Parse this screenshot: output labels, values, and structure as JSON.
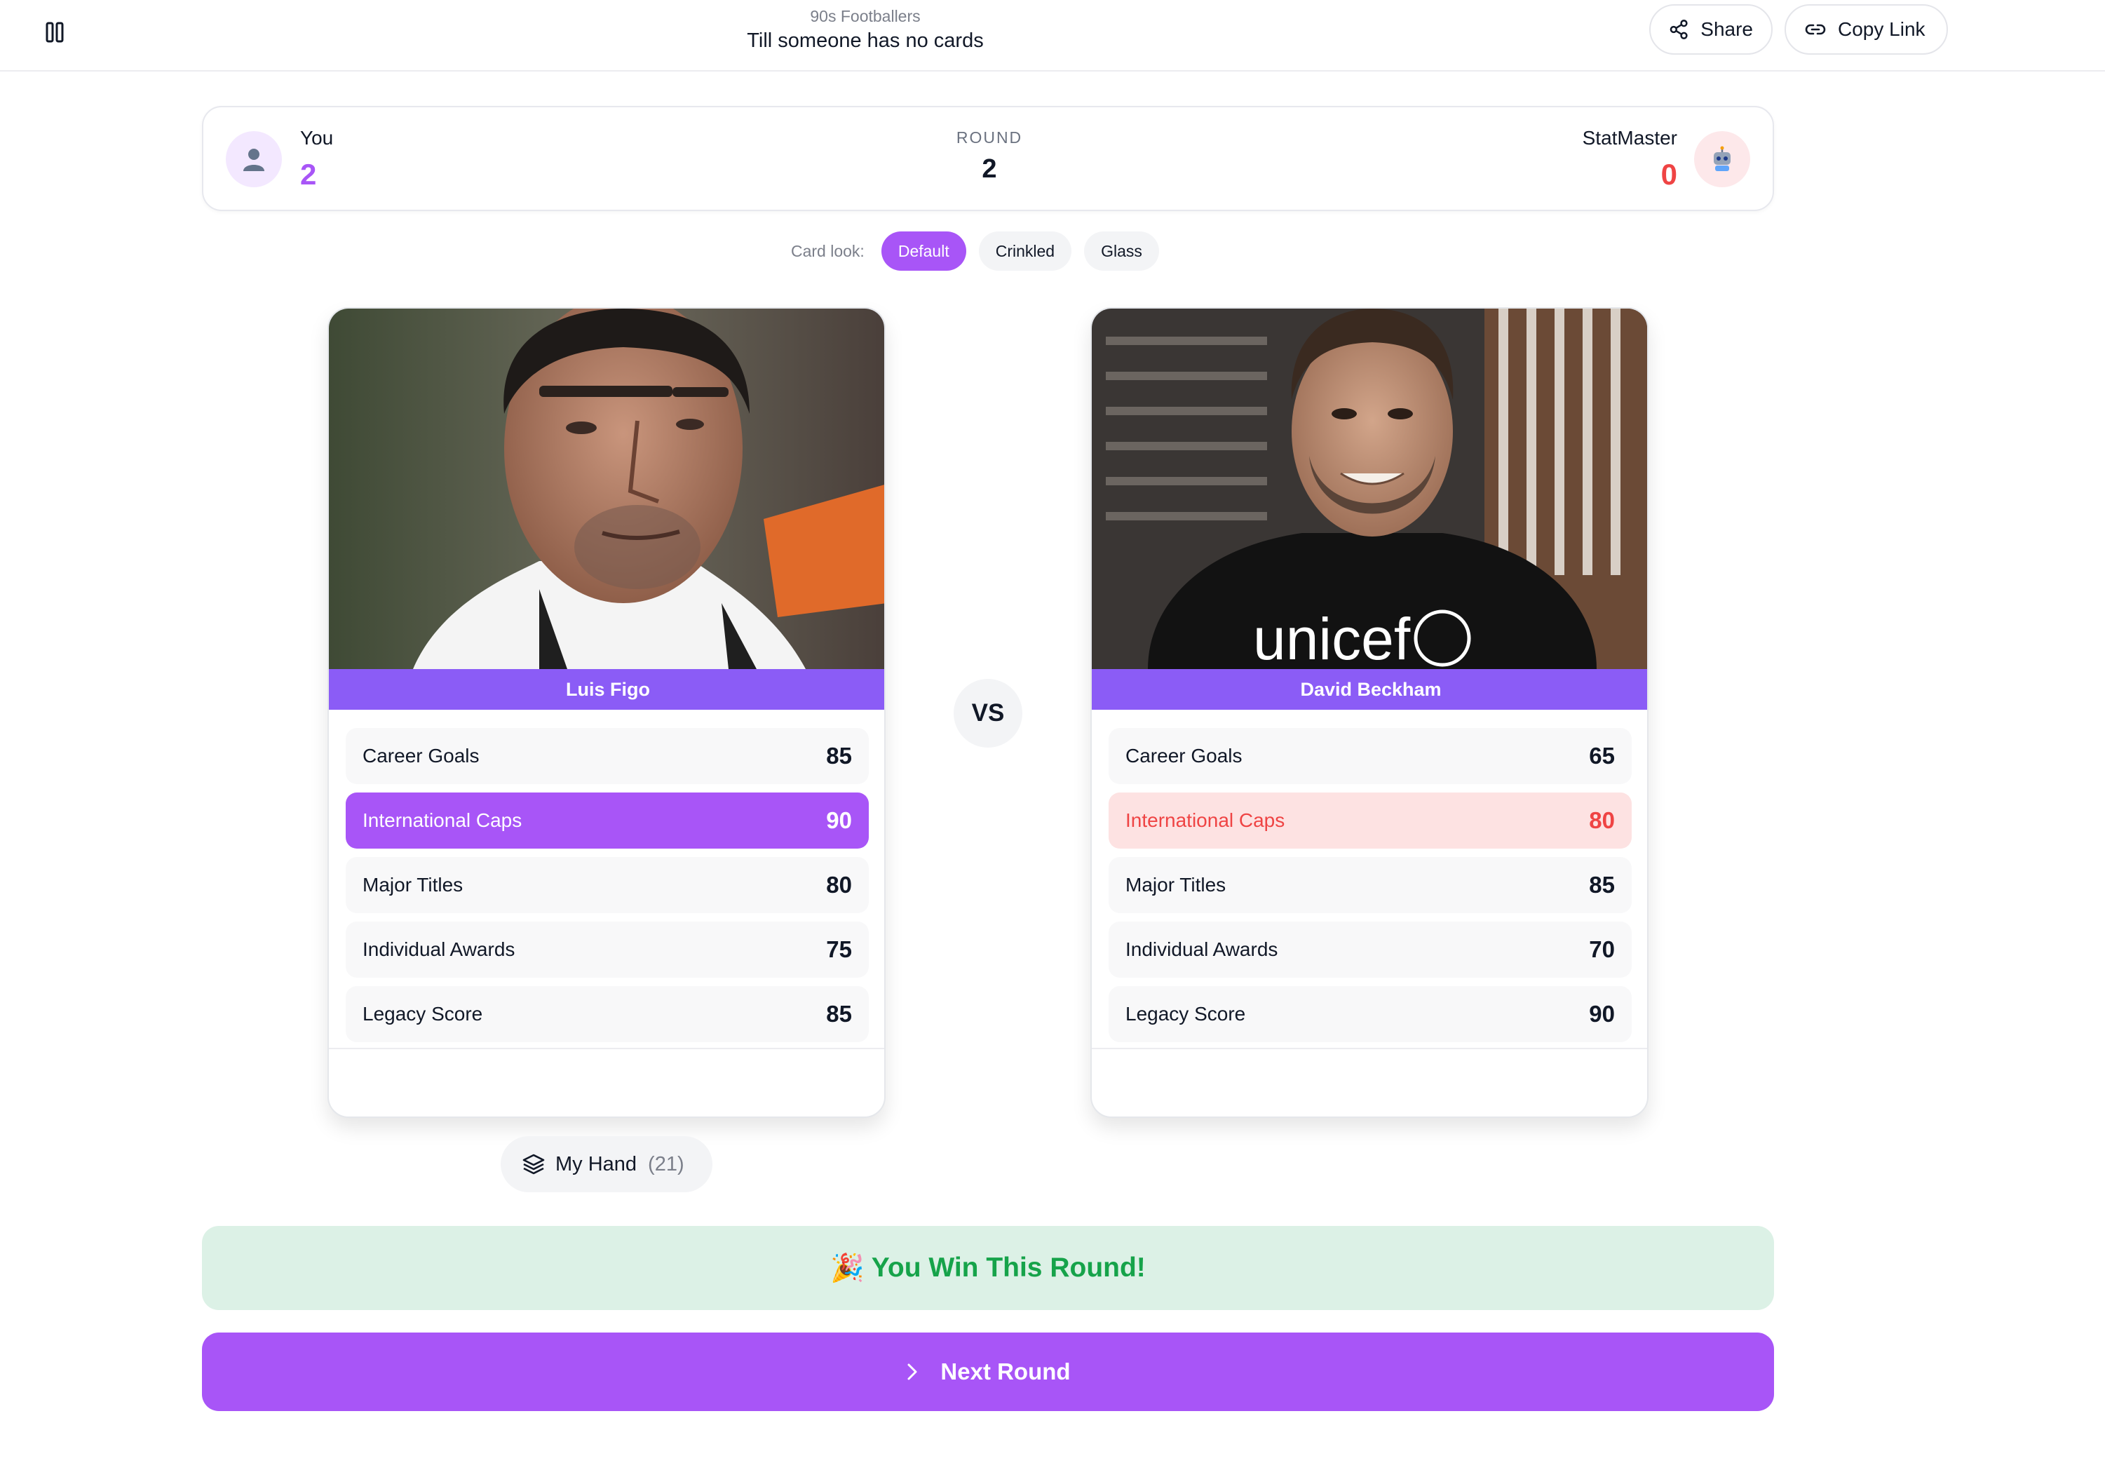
{
  "header": {
    "category": "90s Footballers",
    "mode": "Till someone has no cards",
    "share_label": "Share",
    "copy_link_label": "Copy Link"
  },
  "scoreboard": {
    "player": {
      "name": "You",
      "score": "2"
    },
    "opponent": {
      "name": "StatMaster",
      "score": "0"
    },
    "round_label": "ROUND",
    "round_number": "2"
  },
  "card_look": {
    "label": "Card look:",
    "options": [
      "Default",
      "Crinkled",
      "Glass"
    ],
    "selected": "Default"
  },
  "cards": {
    "player": {
      "name": "Luis Figo",
      "stats": [
        {
          "label": "Career Goals",
          "value": "85"
        },
        {
          "label": "International Caps",
          "value": "90",
          "state": "winner"
        },
        {
          "label": "Major Titles",
          "value": "80"
        },
        {
          "label": "Individual Awards",
          "value": "75"
        },
        {
          "label": "Legacy Score",
          "value": "85"
        }
      ]
    },
    "opponent": {
      "name": "David Beckham",
      "shirt_text": "unicef",
      "stats": [
        {
          "label": "Career Goals",
          "value": "65"
        },
        {
          "label": "International Caps",
          "value": "80",
          "state": "loser"
        },
        {
          "label": "Major Titles",
          "value": "85"
        },
        {
          "label": "Individual Awards",
          "value": "70"
        },
        {
          "label": "Legacy Score",
          "value": "90"
        }
      ]
    }
  },
  "vs_label": "VS",
  "hand": {
    "label": "My Hand",
    "count": "(21)"
  },
  "result": {
    "emoji": "🎉",
    "text": "You Win This Round!"
  },
  "next_round_label": "Next Round",
  "colors": {
    "accent": "#a855f7",
    "card_name_bar": "#8b5cf6",
    "win_text": "#16a34a",
    "win_bg": "#dcf1e6",
    "lose_text": "#ef4444",
    "lose_bg": "#fde2e2"
  },
  "icons": {
    "pause": "pause-icon",
    "share": "share-icon",
    "copy_link": "link-icon",
    "player_avatar": "user-icon",
    "opponent_avatar": "robot-icon",
    "hand": "layers-icon",
    "next": "chevron-right-icon"
  }
}
